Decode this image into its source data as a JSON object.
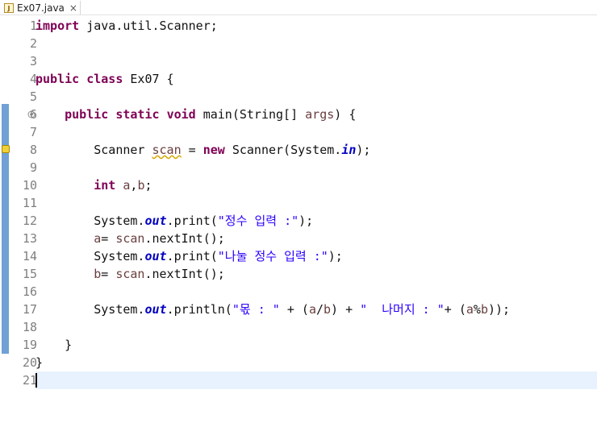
{
  "tab": {
    "label": "Ex07.java",
    "icon": "java-file-icon",
    "close": "×"
  },
  "lines": [
    {
      "n": "1",
      "segs": [
        {
          "t": "import",
          "c": "kw"
        },
        {
          "t": " java.util.Scanner;",
          "c": ""
        }
      ]
    },
    {
      "n": "2",
      "segs": []
    },
    {
      "n": "3",
      "segs": []
    },
    {
      "n": "4",
      "segs": [
        {
          "t": "public",
          "c": "kw"
        },
        {
          "t": " ",
          "c": ""
        },
        {
          "t": "class",
          "c": "kw"
        },
        {
          "t": " Ex07 {",
          "c": ""
        }
      ]
    },
    {
      "n": "5",
      "segs": []
    },
    {
      "n": "6",
      "segs": [
        {
          "t": "    ",
          "c": ""
        },
        {
          "t": "public",
          "c": "kw"
        },
        {
          "t": " ",
          "c": ""
        },
        {
          "t": "static",
          "c": "kw"
        },
        {
          "t": " ",
          "c": ""
        },
        {
          "t": "void",
          "c": "kw"
        },
        {
          "t": " main(String[] ",
          "c": ""
        },
        {
          "t": "args",
          "c": "var"
        },
        {
          "t": ") {",
          "c": ""
        }
      ]
    },
    {
      "n": "7",
      "segs": []
    },
    {
      "n": "8",
      "segs": [
        {
          "t": "        Scanner ",
          "c": ""
        },
        {
          "t": "scan",
          "c": "var warn"
        },
        {
          "t": " = ",
          "c": ""
        },
        {
          "t": "new",
          "c": "kw"
        },
        {
          "t": " Scanner(System.",
          "c": ""
        },
        {
          "t": "in",
          "c": "fld"
        },
        {
          "t": ");",
          "c": ""
        }
      ]
    },
    {
      "n": "9",
      "segs": []
    },
    {
      "n": "10",
      "segs": [
        {
          "t": "        ",
          "c": ""
        },
        {
          "t": "int",
          "c": "kw"
        },
        {
          "t": " ",
          "c": ""
        },
        {
          "t": "a",
          "c": "var"
        },
        {
          "t": ",",
          "c": ""
        },
        {
          "t": "b",
          "c": "var"
        },
        {
          "t": ";",
          "c": ""
        }
      ]
    },
    {
      "n": "11",
      "segs": []
    },
    {
      "n": "12",
      "segs": [
        {
          "t": "        System.",
          "c": ""
        },
        {
          "t": "out",
          "c": "fld"
        },
        {
          "t": ".print(",
          "c": ""
        },
        {
          "t": "\"정수 입력 :\"",
          "c": "str"
        },
        {
          "t": ");",
          "c": ""
        }
      ]
    },
    {
      "n": "13",
      "segs": [
        {
          "t": "        ",
          "c": ""
        },
        {
          "t": "a",
          "c": "var"
        },
        {
          "t": "= ",
          "c": ""
        },
        {
          "t": "scan",
          "c": "var"
        },
        {
          "t": ".nextInt();",
          "c": ""
        }
      ]
    },
    {
      "n": "14",
      "segs": [
        {
          "t": "        System.",
          "c": ""
        },
        {
          "t": "out",
          "c": "fld"
        },
        {
          "t": ".print(",
          "c": ""
        },
        {
          "t": "\"나눌 정수 입력 :\"",
          "c": "str"
        },
        {
          "t": ");",
          "c": ""
        }
      ]
    },
    {
      "n": "15",
      "segs": [
        {
          "t": "        ",
          "c": ""
        },
        {
          "t": "b",
          "c": "var"
        },
        {
          "t": "= ",
          "c": ""
        },
        {
          "t": "scan",
          "c": "var"
        },
        {
          "t": ".nextInt();",
          "c": ""
        }
      ]
    },
    {
      "n": "16",
      "segs": []
    },
    {
      "n": "17",
      "segs": [
        {
          "t": "        System.",
          "c": ""
        },
        {
          "t": "out",
          "c": "fld"
        },
        {
          "t": ".println(",
          "c": ""
        },
        {
          "t": "\"몫 : \"",
          "c": "str"
        },
        {
          "t": " + (",
          "c": ""
        },
        {
          "t": "a",
          "c": "var"
        },
        {
          "t": "/",
          "c": ""
        },
        {
          "t": "b",
          "c": "var"
        },
        {
          "t": ") + ",
          "c": ""
        },
        {
          "t": "\"  나머지 : \"",
          "c": "str"
        },
        {
          "t": "+ (",
          "c": ""
        },
        {
          "t": "a",
          "c": "var"
        },
        {
          "t": "%",
          "c": ""
        },
        {
          "t": "b",
          "c": "var"
        },
        {
          "t": "));",
          "c": ""
        }
      ]
    },
    {
      "n": "18",
      "segs": []
    },
    {
      "n": "19",
      "segs": [
        {
          "t": "    }",
          "c": ""
        }
      ]
    },
    {
      "n": "20",
      "segs": [
        {
          "t": "}",
          "c": ""
        }
      ]
    },
    {
      "n": "21",
      "segs": []
    }
  ],
  "colors": {
    "keyword": "#7f0055",
    "string": "#2a00ff",
    "field": "#0000c0",
    "local": "#6a3e3e",
    "current_line": "#e8f2fe",
    "ruler": "#6fa0d6"
  }
}
